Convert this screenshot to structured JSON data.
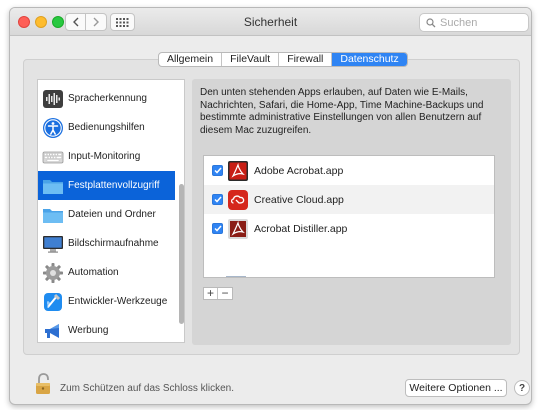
{
  "window": {
    "title": "Sicherheit"
  },
  "search": {
    "placeholder": "Suchen"
  },
  "tabs": [
    {
      "label": "Allgemein"
    },
    {
      "label": "FileVault"
    },
    {
      "label": "Firewall"
    },
    {
      "label": "Datenschutz",
      "active": true
    }
  ],
  "sidebar": {
    "items": [
      {
        "label": "Spracherkennung",
        "icon": "waveform-icon"
      },
      {
        "label": "Bedienungshilfen",
        "icon": "accessibility-icon"
      },
      {
        "label": "Input-Monitoring",
        "icon": "keyboard-icon"
      },
      {
        "label": "Festplattenvollzugriff",
        "icon": "folder-icon",
        "selected": true
      },
      {
        "label": "Dateien und Ordner",
        "icon": "folder-icon"
      },
      {
        "label": "Bildschirmaufnahme",
        "icon": "display-icon"
      },
      {
        "label": "Automation",
        "icon": "gear-icon"
      },
      {
        "label": "Entwickler-Werkzeuge",
        "icon": "xcode-icon"
      },
      {
        "label": "Werbung",
        "icon": "megaphone-icon"
      }
    ]
  },
  "detail": {
    "description": "Den unten stehenden Apps erlauben, auf Daten wie E-Mails, Nachrichten, Safari, die Home-App, Time Machine-Backups und bestimmte administrative Einstellungen von allen Benutzern auf diesem Mac zuzugreifen.",
    "apps": [
      {
        "name": "Adobe Acrobat.app",
        "checked": true,
        "icon": "acrobat-icon"
      },
      {
        "name": "Creative Cloud.app",
        "checked": true,
        "icon": "creative-cloud-icon"
      },
      {
        "name": "Acrobat Distiller.app",
        "checked": true,
        "icon": "distiller-icon"
      }
    ],
    "add_label": "+",
    "remove_label": "−"
  },
  "footer": {
    "lock_text": "Zum Schützen auf das Schloss klicken.",
    "more_options": "Weitere Optionen ...",
    "help": "?"
  },
  "colors": {
    "accent": "#2f84f3",
    "selection": "#0b63d9",
    "folder": "#5fb4f0",
    "adobe_red": "#d0251c"
  }
}
